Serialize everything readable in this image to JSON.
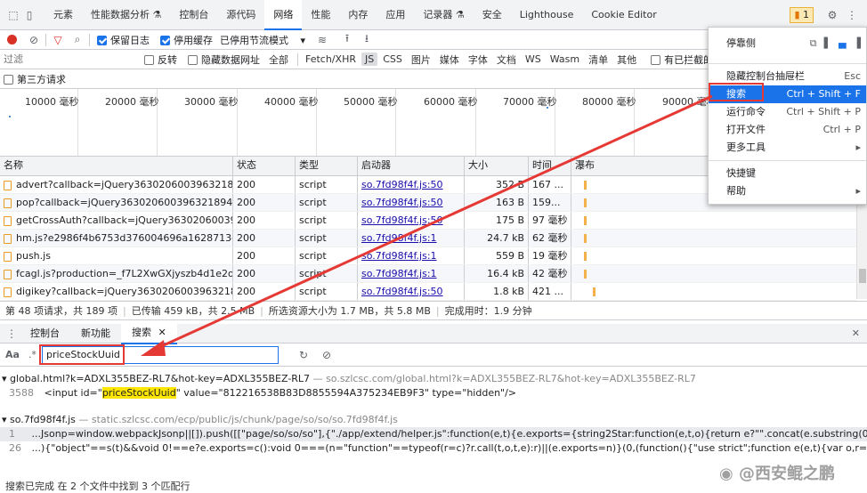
{
  "tabs": [
    "元素",
    "性能数据分析 ⚗",
    "控制台",
    "源代码",
    "网络",
    "性能",
    "内存",
    "应用",
    "记录器 ⚗",
    "安全",
    "Lighthouse",
    "Cookie Editor"
  ],
  "active_tab": "网络",
  "issues_badge": "1",
  "toolbar1": {
    "preserve_log": "保留日志",
    "disable_cache": "停用缓存",
    "throttle": "已停用节流模式"
  },
  "filter": {
    "placeholder": "过滤",
    "invert": "反转",
    "hide_data_urls": "隐藏数据网址",
    "types": [
      "全部",
      "Fetch/XHR",
      "JS",
      "CSS",
      "图片",
      "媒体",
      "字体",
      "文档",
      "WS",
      "Wasm",
      "清单",
      "其他"
    ],
    "selected_type": "JS",
    "blocked_cookies": "有已拦截的 Co"
  },
  "third_party": "第三方请求",
  "timeline_ticks": [
    "10000 毫秒",
    "20000 毫秒",
    "30000 毫秒",
    "40000 毫秒",
    "50000 毫秒",
    "60000 毫秒",
    "70000 毫秒",
    "80000 毫秒",
    "90000 毫秒"
  ],
  "grid": {
    "headers": [
      "名称",
      "状态",
      "类型",
      "启动器",
      "大小",
      "时间",
      "瀑布"
    ],
    "rows": [
      {
        "name": "advert?callback=jQuery363020600396321894...",
        "status": "200",
        "type": "script",
        "initiator": "so.7fd98f4f.js:50",
        "size": "352 B",
        "time": "167 ..."
      },
      {
        "name": "pop?callback=jQuery363020600396321894920...",
        "status": "200",
        "type": "script",
        "initiator": "so.7fd98f4f.js:50",
        "size": "163 B",
        "time": "159..."
      },
      {
        "name": "getCrossAuth?callback=jQuery36302060039...",
        "status": "200",
        "type": "script",
        "initiator": "so.7fd98f4f.js:50",
        "size": "175 B",
        "time": "97 毫秒"
      },
      {
        "name": "hm.js?e2986f4b6753d376004696a1628713d2",
        "status": "200",
        "type": "script",
        "initiator": "so.7fd98f4f.js:1",
        "size": "24.7 kB",
        "time": "62 毫秒"
      },
      {
        "name": "push.js",
        "status": "200",
        "type": "script",
        "initiator": "so.7fd98f4f.js:1",
        "size": "559 B",
        "time": "19 毫秒"
      },
      {
        "name": "fcagl.js?production=_f7L2XwGXjyszb4d1e2oxP...",
        "status": "200",
        "type": "script",
        "initiator": "so.7fd98f4f.js:1",
        "size": "16.4 kB",
        "time": "42 毫秒"
      },
      {
        "name": "digikey?callback=jQuery363020600396321894...",
        "status": "200",
        "type": "script",
        "initiator": "so.7fd98f4f.js:50",
        "size": "1.8 kB",
        "time": "421 ..."
      }
    ]
  },
  "status": {
    "requests": "第 48 项请求，共 189 项",
    "transferred": "已传输 459 kB，共 2.5 MB",
    "resources": "所选资源大小为 1.7 MB，共 5.8 MB",
    "finish": "完成用时：1.9 分钟"
  },
  "drawer_tabs": [
    "控制台",
    "新功能",
    "搜索"
  ],
  "drawer_active": "搜索",
  "search": {
    "case_label": "Aa",
    "regex_label": ".*",
    "query": "priceStockUuid"
  },
  "results": [
    {
      "file": "global.html?k=ADXL355BEZ-RL7&hot-key=ADXL355BEZ-RL7",
      "url": "so.szlcsc.com/global.html?k=ADXL355BEZ-RL7&hot-key=ADXL355BEZ-RL7",
      "lines": [
        {
          "num": "3588",
          "pre": "<input id=\"",
          "match": "priceStockUuid",
          "post": "\" value=\"812216538B83D8855594A375234EB9F3\" type=\"hidden\"/>"
        }
      ]
    },
    {
      "file": "so.7fd98f4f.js",
      "url": "static.szlcsc.com/ecp/public/js/chunk/page/so/so/so.7fd98f4f.js",
      "lines": [
        {
          "num": "1",
          "pre": "...Jsonp=window.webpackJsonp||[]).push([[\"page/so/so/so\"],{\"./app/extend/helper.js\":function(e,t){e.exports={string2Star:function(e,t,o){return e?\"\".concat(e.substring(0,t),\"***\").concat(e.substring(e.",
          "match": "",
          "post": ""
        },
        {
          "num": "26",
          "pre": "...){\"object\"==s(t)&&void 0!==e?e.exports=c():void 0===(n=\"function\"==typeof(r=c)?r.call(t,o,t,e):r)||(e.exports=n)}(0,(function(){\"use strict\";function e(e,t){var o,r=Object.keys(e);return Object.g",
          "match": "",
          "post": ""
        }
      ]
    }
  ],
  "bottom_status": "搜索已完成   在 2 个文件中找到 3 个匹配行",
  "menu": {
    "dock_label": "停靠侧",
    "items": [
      {
        "label": "隐藏控制台抽屉栏",
        "shortcut": "Esc"
      },
      {
        "label": "搜索",
        "shortcut": "Ctrl + Shift + F"
      },
      {
        "label": "运行命令",
        "shortcut": "Ctrl + Shift + P"
      },
      {
        "label": "打开文件",
        "shortcut": "Ctrl + P"
      },
      {
        "label": "更多工具",
        "shortcut": "▸"
      },
      {
        "label": "快捷键",
        "shortcut": ""
      },
      {
        "label": "帮助",
        "shortcut": "▸"
      }
    ],
    "highlighted": "搜索"
  },
  "watermark": "@西安鲲之鹏",
  "colors": {
    "accent": "#1a73e8",
    "annotation": "#e53935",
    "highlight": "#ffe600"
  }
}
